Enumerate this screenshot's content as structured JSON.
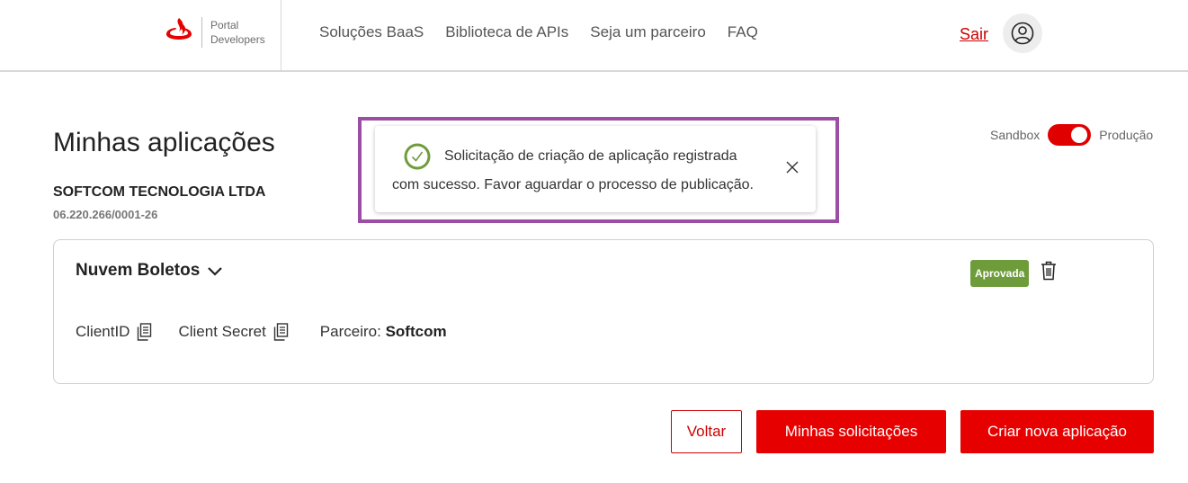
{
  "header": {
    "logo_icon": "santander-flame-icon",
    "logo_line1": "Portal",
    "logo_line2": "Developers",
    "nav": [
      {
        "label": "Soluções BaaS"
      },
      {
        "label": "Biblioteca de APIs"
      },
      {
        "label": "Seja um parceiro"
      },
      {
        "label": "FAQ"
      }
    ],
    "logout_label": "Sair",
    "avatar_icon": "user-icon"
  },
  "page": {
    "title": "Minhas aplicações",
    "company_name": "SOFTCOM TECNOLOGIA LTDA",
    "cnpj": "06.220.266/0001-26"
  },
  "environment_toggle": {
    "left_label": "Sandbox",
    "right_label": "Produção",
    "selected": "Produção"
  },
  "toast": {
    "icon": "check-circle-icon",
    "line1": "Solicitação de criação de aplicação registrada",
    "line2": "com sucesso. Favor aguardar o processo de publicação.",
    "close_icon": "close-icon"
  },
  "application": {
    "name": "Nuvem Boletos",
    "status": "Aprovada",
    "client_id_label": "ClientID",
    "client_secret_label": "Client Secret",
    "partner_label": "Parceiro:",
    "partner_value": "Softcom"
  },
  "actions": {
    "back": "Voltar",
    "my_requests": "Minhas solicitações",
    "create_new": "Criar nova aplicação"
  },
  "colors": {
    "brand_red": "#e60000",
    "success_green": "#6f9c3b",
    "highlight_purple": "#9b4ea3"
  }
}
